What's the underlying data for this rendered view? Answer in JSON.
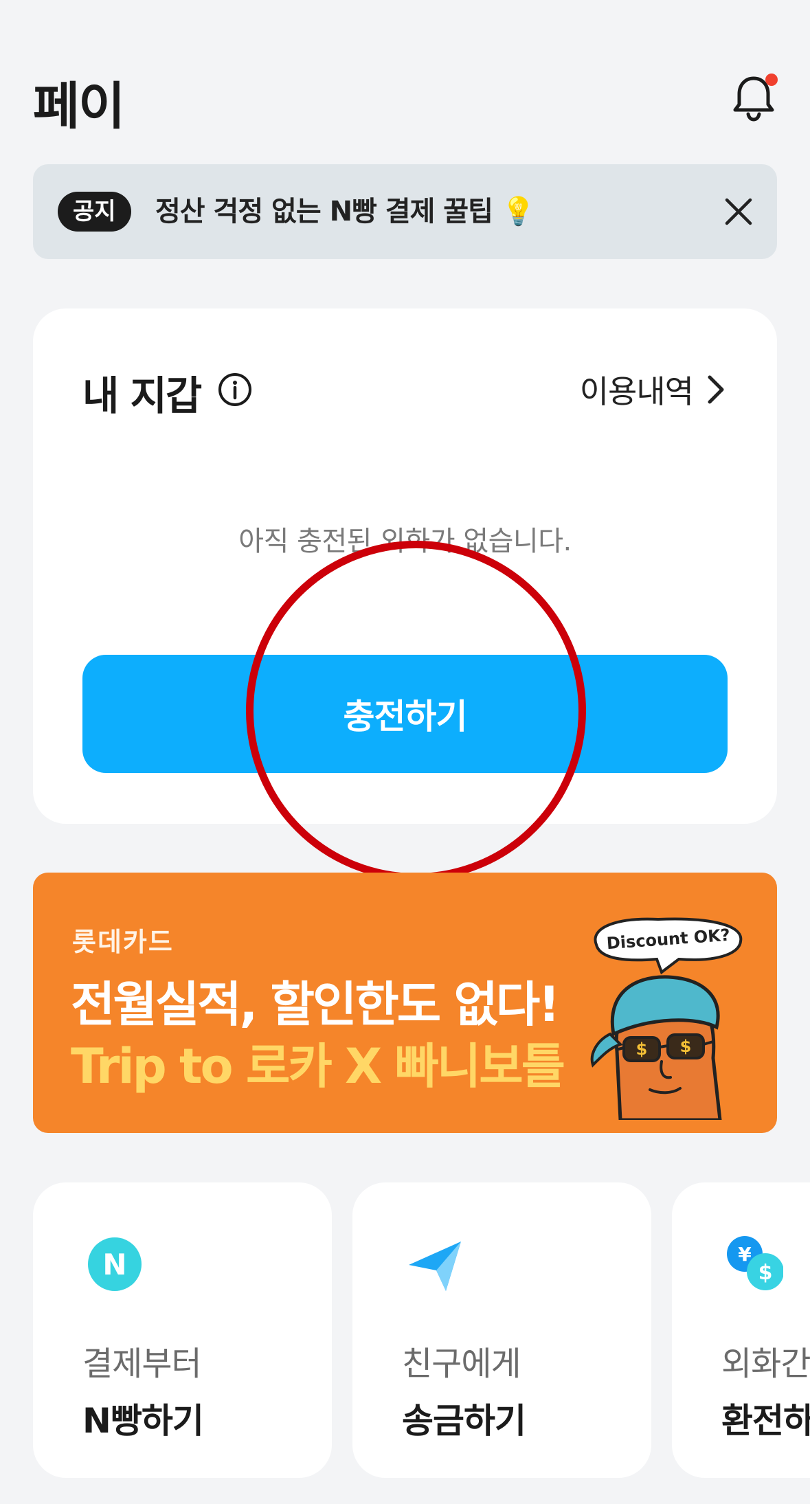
{
  "header": {
    "title": "페이",
    "notification_badge": true
  },
  "notice": {
    "badge": "공지",
    "text": "정산 걱정 없는 N빵 결제 꿀팁 💡"
  },
  "wallet": {
    "title": "내 지갑",
    "history_label": "이용내역",
    "empty_message": "아직 충전된 외화가 없습니다.",
    "charge_button": "충전하기"
  },
  "banner": {
    "brand": "롯데카드",
    "headline": "전월실적, 할인한도 없다!",
    "subheadline": "Trip to 로카 X 빠니보틀",
    "speech_bubble": "Discount OK?",
    "bg_color": "#f5852a"
  },
  "shortcuts": [
    {
      "icon": "n-circle-icon",
      "icon_text": "N",
      "sub": "결제부터",
      "main": "N빵하기"
    },
    {
      "icon": "paper-plane-icon",
      "sub": "친구에게",
      "main": "송금하기"
    },
    {
      "icon": "currency-exchange-icon",
      "sub": "외화간",
      "main": "환전하기"
    }
  ],
  "colors": {
    "accent": "#0daefd",
    "highlight_ring": "#cc0009",
    "notification_dot": "#f0402e"
  }
}
